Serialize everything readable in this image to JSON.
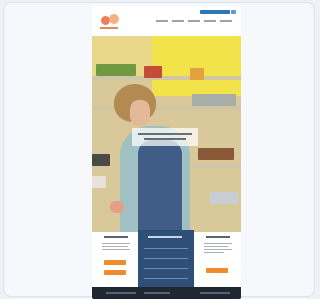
{
  "page": {
    "description_hidden": true,
    "accent_orange": "#f08a2e",
    "accent_blue": "#2f74b5",
    "panel_blue": "#2d4f78"
  },
  "header": {
    "logo_icon": "logo-icon",
    "nav_items": [
      "",
      "",
      "",
      "",
      ""
    ],
    "top_button_label": ""
  },
  "hero": {
    "image_icon": "hero-photo",
    "overlay_text": ""
  },
  "cards": {
    "left": {
      "title": "",
      "button_label": ""
    },
    "middle": {
      "title": ""
    },
    "right": {
      "title": "",
      "button_label": ""
    }
  },
  "footer": {
    "text": ""
  }
}
